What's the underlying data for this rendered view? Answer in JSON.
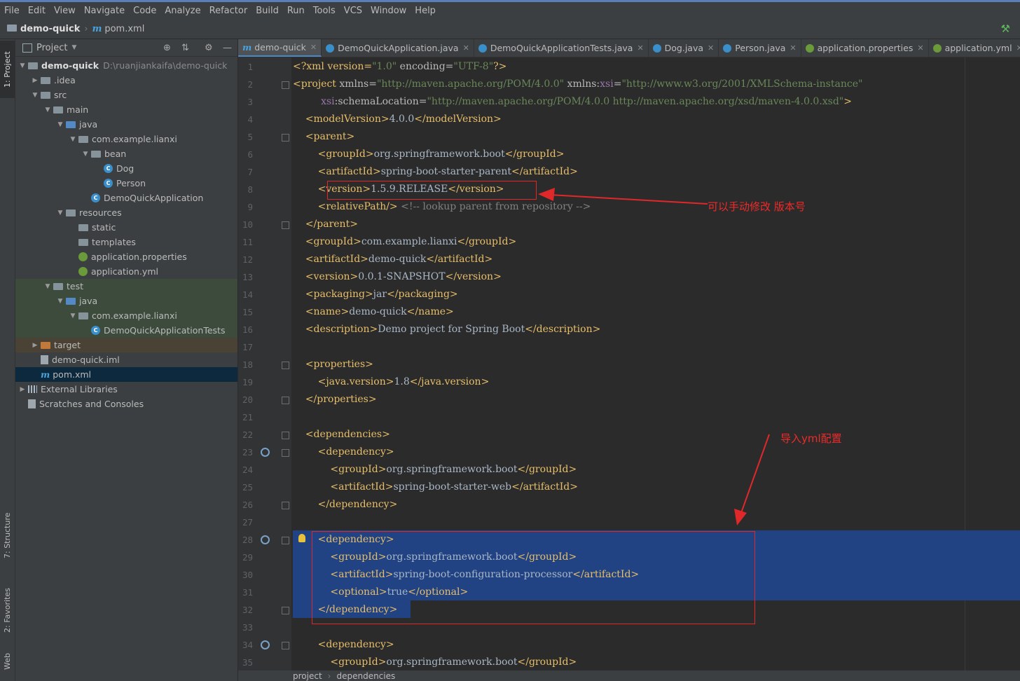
{
  "menu": [
    "File",
    "Edit",
    "View",
    "Navigate",
    "Code",
    "Analyze",
    "Refactor",
    "Build",
    "Run",
    "Tools",
    "VCS",
    "Window",
    "Help"
  ],
  "breadcrumb": {
    "project": "demo-quick",
    "file": "pom.xml"
  },
  "side_tabs": {
    "project": "1: Project",
    "structure": "7: Structure",
    "favorites": "2: Favorites",
    "web": "Web"
  },
  "project_panel": {
    "title": "Project",
    "tree": [
      {
        "label": "demo-quick",
        "path": "D:\\ruanjiankaifa\\demo-quick"
      },
      {
        "label": ".idea"
      },
      {
        "label": "src"
      },
      {
        "label": "main"
      },
      {
        "label": "java"
      },
      {
        "label": "com.example.lianxi"
      },
      {
        "label": "bean"
      },
      {
        "label": "Dog"
      },
      {
        "label": "Person"
      },
      {
        "label": "DemoQuickApplication"
      },
      {
        "label": "resources"
      },
      {
        "label": "static"
      },
      {
        "label": "templates"
      },
      {
        "label": "application.properties"
      },
      {
        "label": "application.yml"
      },
      {
        "label": "test"
      },
      {
        "label": "java"
      },
      {
        "label": "com.example.lianxi"
      },
      {
        "label": "DemoQuickApplicationTests"
      },
      {
        "label": "target"
      },
      {
        "label": "demo-quick.iml"
      },
      {
        "label": "pom.xml"
      },
      {
        "label": "External Libraries"
      },
      {
        "label": "Scratches and Consoles"
      }
    ]
  },
  "editor_tabs": [
    "demo-quick",
    "DemoQuickApplication.java",
    "DemoQuickApplicationTests.java",
    "Dog.java",
    "Person.java",
    "application.properties",
    "application.yml"
  ],
  "code_lines": [
    [
      "<?xml version=",
      "\"1.0\"",
      " encoding=",
      "\"UTF-8\"",
      "?>"
    ],
    [
      "<project ",
      "xmlns=",
      "\"http://maven.apache.org/POM/4.0.0\"",
      " xmlns:",
      "xsi",
      "=",
      "\"http://www.w3.org/2001/XMLSchema-instance\""
    ],
    [
      "         ",
      "xsi",
      ":schemaLocation=",
      "\"http://maven.apache.org/POM/4.0.0 http://maven.apache.org/xsd/maven-4.0.0.xsd\"",
      ">"
    ],
    [
      "    ",
      "<modelVersion>",
      "4.0.0",
      "</modelVersion>"
    ],
    [
      "    ",
      "<parent>"
    ],
    [
      "        ",
      "<groupId>",
      "org.springframework.boot",
      "</groupId>"
    ],
    [
      "        ",
      "<artifactId>",
      "spring-boot-starter-parent",
      "</artifactId>"
    ],
    [
      "        ",
      "<version>",
      "1.5.9.RELEASE",
      "</version>"
    ],
    [
      "        ",
      "<relativePath/>",
      " <!-- lookup parent from repository -->"
    ],
    [
      "    ",
      "</parent>"
    ],
    [
      "    ",
      "<groupId>",
      "com.example.lianxi",
      "</groupId>"
    ],
    [
      "    ",
      "<artifactId>",
      "demo-quick",
      "</artifactId>"
    ],
    [
      "    ",
      "<version>",
      "0.0.1-SNAPSHOT",
      "</version>"
    ],
    [
      "    ",
      "<packaging>",
      "jar",
      "</packaging>"
    ],
    [
      "    ",
      "<name>",
      "demo-quick",
      "</name>"
    ],
    [
      "    ",
      "<description>",
      "Demo project for Spring Boot",
      "</description>"
    ],
    [
      ""
    ],
    [
      "    ",
      "<properties>"
    ],
    [
      "        ",
      "<java.version>",
      "1.8",
      "</java.version>"
    ],
    [
      "    ",
      "</properties>"
    ],
    [
      ""
    ],
    [
      "    ",
      "<dependencies>"
    ],
    [
      "        ",
      "<dependency>"
    ],
    [
      "            ",
      "<groupId>",
      "org.springframework.boot",
      "</groupId>"
    ],
    [
      "            ",
      "<artifactId>",
      "spring-boot-starter-web",
      "</artifactId>"
    ],
    [
      "        ",
      "</dependency>"
    ],
    [
      ""
    ],
    [
      "        ",
      "<dependency>"
    ],
    [
      "            ",
      "<groupId>",
      "org.springframework.boot",
      "</groupId>"
    ],
    [
      "            ",
      "<artifactId>",
      "spring-boot-configuration-processor",
      "</artifactId>"
    ],
    [
      "            ",
      "<optional>",
      "true",
      "</optional>"
    ],
    [
      "        ",
      "</dependency>"
    ],
    [
      ""
    ],
    [
      "        ",
      "<dependency>"
    ],
    [
      "            ",
      "<groupId>",
      "org.springframework.boot",
      "</groupId>"
    ]
  ],
  "annotations": {
    "version_note": "可以手动修改 版本号",
    "yml_note": "导入yml配置"
  },
  "status_breadcrumb": [
    "project",
    "dependencies"
  ],
  "colors": {
    "tag": "#e8bf6a",
    "value": "#6a8759",
    "comment": "#808080",
    "selection": "#214283",
    "annotation": "#e0282b"
  }
}
